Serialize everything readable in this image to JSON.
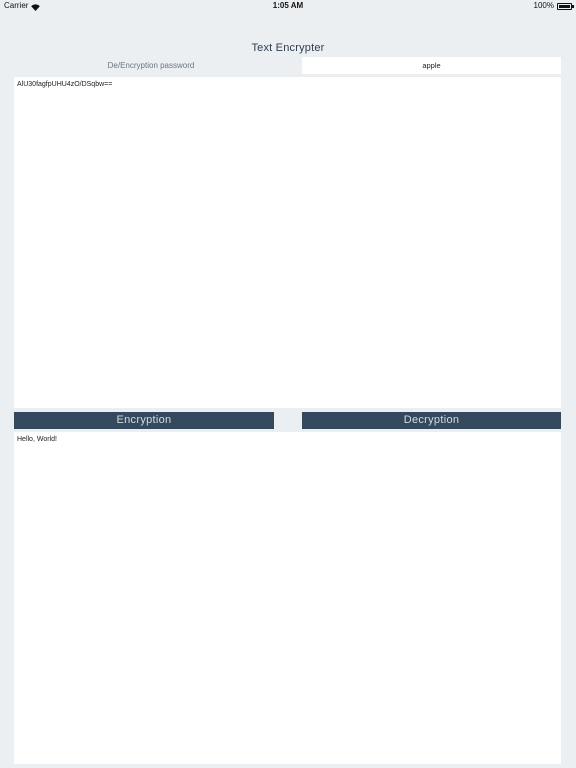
{
  "status_bar": {
    "carrier": "Carrier",
    "time": "1:05 AM",
    "battery": "100%"
  },
  "title": "Text Encrypter",
  "password": {
    "label": "De/Encryption password",
    "value": "apple"
  },
  "cipher_text": "AlU30fagfpUHU4zO/DSqbw==",
  "plain_text": "Hello, World!",
  "buttons": {
    "encrypt": "Encryption",
    "decrypt": "Decryption"
  },
  "colors": {
    "background": "#eceff1",
    "button": "#34495e",
    "button_text": "#d4dbe2",
    "title": "#2c3e50"
  }
}
